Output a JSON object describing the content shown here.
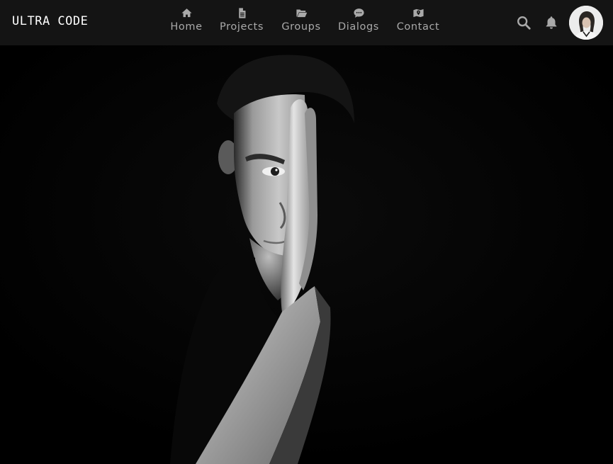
{
  "brand": {
    "logo": "ULTRA CODE"
  },
  "nav": {
    "items": [
      {
        "label": "Home",
        "icon": "home-icon"
      },
      {
        "label": "Projects",
        "icon": "document-icon"
      },
      {
        "label": "Groups",
        "icon": "folder-open-icon"
      },
      {
        "label": "Dialogs",
        "icon": "chat-bubble-icon"
      },
      {
        "label": "Contact",
        "icon": "map-marker-icon"
      }
    ]
  },
  "toolbar": {
    "search_icon": "search-icon",
    "notifications_icon": "bell-icon",
    "avatar": "user-avatar"
  },
  "colors": {
    "navbar_bg": "#141414",
    "nav_text": "#a9a9a9",
    "logo_text": "#ffffff",
    "page_bg": "#000000"
  },
  "hero": {
    "image": "black-and-white portrait of a young man covering half of his face with his hand"
  }
}
